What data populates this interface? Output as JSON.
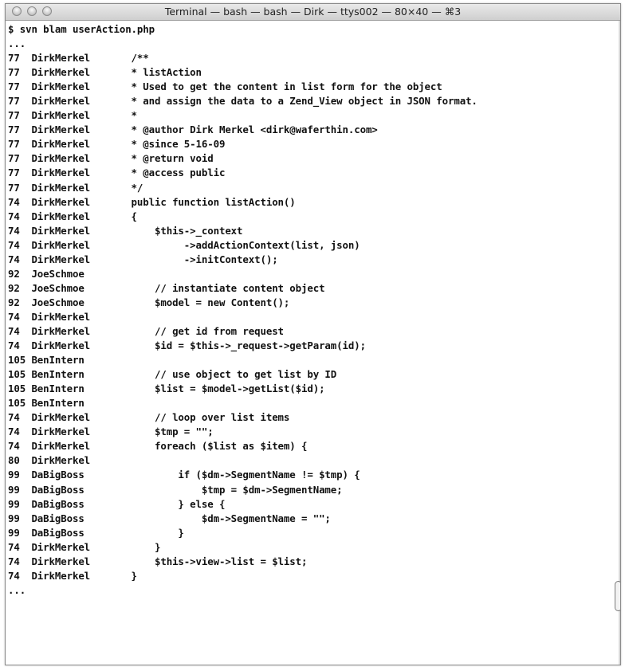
{
  "window": {
    "title": "Terminal — bash — bash — Dirk — ttys002 — 80×40 — ⌘3"
  },
  "terminal": {
    "lines": [
      "$ svn blam userAction.php",
      "...",
      "77  DirkMerkel       /**",
      "77  DirkMerkel       * listAction",
      "77  DirkMerkel       * Used to get the content in list form for the object",
      "77  DirkMerkel       * and assign the data to a Zend_View object in JSON format.",
      "77  DirkMerkel       *",
      "77  DirkMerkel       * @author Dirk Merkel <dirk@waferthin.com>",
      "77  DirkMerkel       * @since 5-16-09",
      "77  DirkMerkel       * @return void",
      "77  DirkMerkel       * @access public",
      "77  DirkMerkel       */",
      "74  DirkMerkel       public function listAction()",
      "74  DirkMerkel       {",
      "74  DirkMerkel           $this->_context",
      "74  DirkMerkel                ->addActionContext(list, json)",
      "74  DirkMerkel                ->initContext();",
      "92  JoeSchmoe",
      "92  JoeSchmoe            // instantiate content object",
      "92  JoeSchmoe            $model = new Content();",
      "74  DirkMerkel",
      "74  DirkMerkel           // get id from request",
      "74  DirkMerkel           $id = $this->_request->getParam(id);",
      "105 BenIntern",
      "105 BenIntern            // use object to get list by ID",
      "105 BenIntern            $list = $model->getList($id);",
      "105 BenIntern",
      "74  DirkMerkel           // loop over list items",
      "74  DirkMerkel           $tmp = \"\";",
      "74  DirkMerkel           foreach ($list as $item) {",
      "80  DirkMerkel",
      "99  DaBigBoss                if ($dm->SegmentName != $tmp) {",
      "99  DaBigBoss                    $tmp = $dm->SegmentName;",
      "99  DaBigBoss                } else {",
      "99  DaBigBoss                    $dm->SegmentName = \"\";",
      "99  DaBigBoss                }",
      "74  DirkMerkel           }",
      "74  DirkMerkel           $this->view->list = $list;",
      "74  DirkMerkel       }",
      "..."
    ]
  }
}
